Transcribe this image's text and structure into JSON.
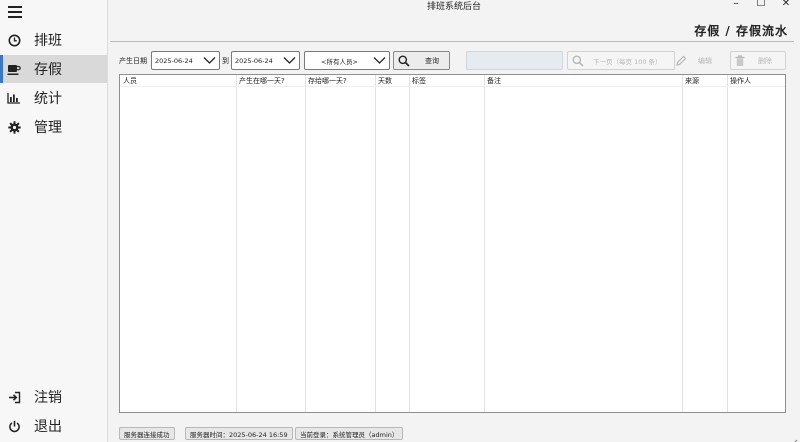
{
  "window": {
    "title": "排班系统后台",
    "controls": [
      "–",
      "☐",
      "✕"
    ]
  },
  "sidebar": {
    "menu_icon": "hamburger-icon",
    "items": [
      {
        "label": "排班",
        "icon": "clock-icon"
      },
      {
        "label": "存假",
        "icon": "cup-icon",
        "active": true
      },
      {
        "label": "统计",
        "icon": "bar-chart-icon"
      },
      {
        "label": "管理",
        "icon": "gear-icon"
      }
    ],
    "bottom_items": [
      {
        "label": "注销",
        "icon": "logout-icon"
      },
      {
        "label": "退出",
        "icon": "power-icon"
      }
    ]
  },
  "header": {
    "title": "存假 / 存假流水"
  },
  "toolbar": {
    "date_label": "产生日期",
    "start_date": "2025-06-24",
    "to_label": "到",
    "end_date": "2025-06-24",
    "person_select": "<所有人员>",
    "query_label": "查询",
    "next_page_label": "下一页（每页 100 条）",
    "edit_label": "编辑",
    "delete_label": "删除"
  },
  "table": {
    "columns": [
      "人员",
      "产生在哪一天?",
      "存给哪一天?",
      "天数",
      "标签",
      "备注",
      "来源",
      "操作人"
    ],
    "rows": []
  },
  "status_bar": {
    "connection": "服务器连接成功",
    "server_time": "服务器时间：2025-06-24 16:59",
    "current_login": "当前登录：系统管理员（admin）"
  },
  "colors": {
    "accent": "#3a78c7",
    "active_nav_bg": "#d9d9d9",
    "header_line": "#9ec2e8"
  }
}
